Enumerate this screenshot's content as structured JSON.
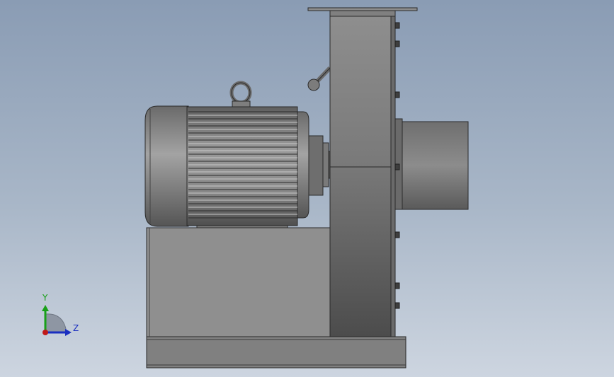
{
  "viewport": {
    "background_top": "#8a9cb4",
    "background_bottom": "#cdd5e0"
  },
  "model": {
    "components": [
      "base-frame",
      "motor-pedestal",
      "electric-motor",
      "lifting-eye",
      "motor-fins",
      "coupling",
      "blower-housing",
      "mounting-flange",
      "fan-lever",
      "outlet-duct",
      "housing-bolts"
    ]
  },
  "triad": {
    "y_label": "Y",
    "z_label": "Z",
    "y_color": "#18a018",
    "z_color": "#1a2fc0",
    "x_color": "#c01818"
  }
}
